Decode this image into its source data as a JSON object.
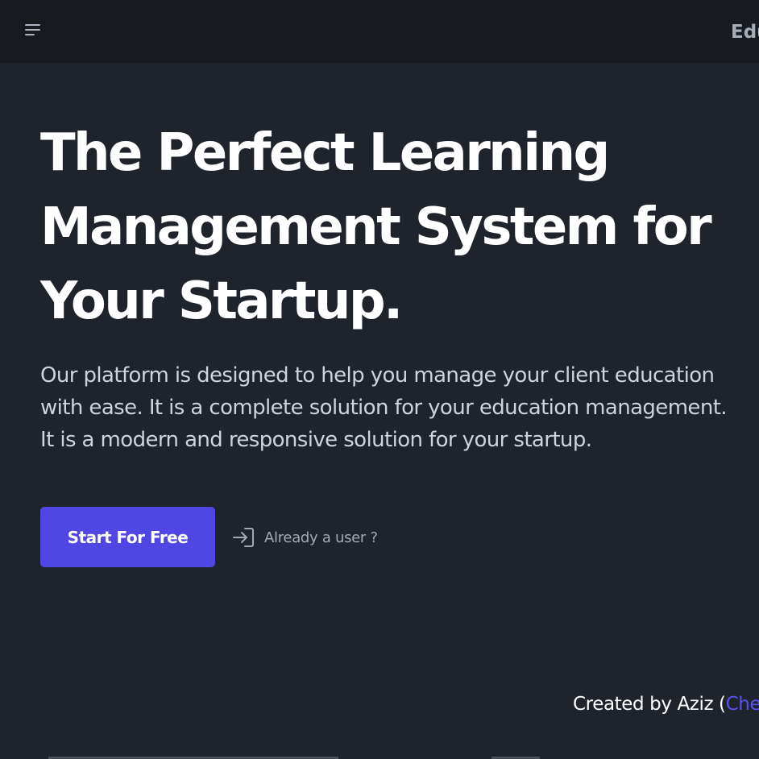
{
  "header": {
    "menu_icon": "menu-icon",
    "brand_text": "Edu"
  },
  "hero": {
    "headline": "The Perfect Learning Management System for Your Startup.",
    "description": "Our platform is designed to help you manage your client education with ease. It is a complete solution for your education management. It is a modern and responsive solution for your startup.",
    "cta_label": "Start For Free",
    "login_icon": "login-icon",
    "login_label": "Already a user ?"
  },
  "footer": {
    "credit_prefix": "Created by Aziz (",
    "credit_link": "Che"
  },
  "colors": {
    "background": "#1f232b",
    "topbar": "#171a1f",
    "accent": "#5046e4",
    "link": "#5a52ee"
  }
}
